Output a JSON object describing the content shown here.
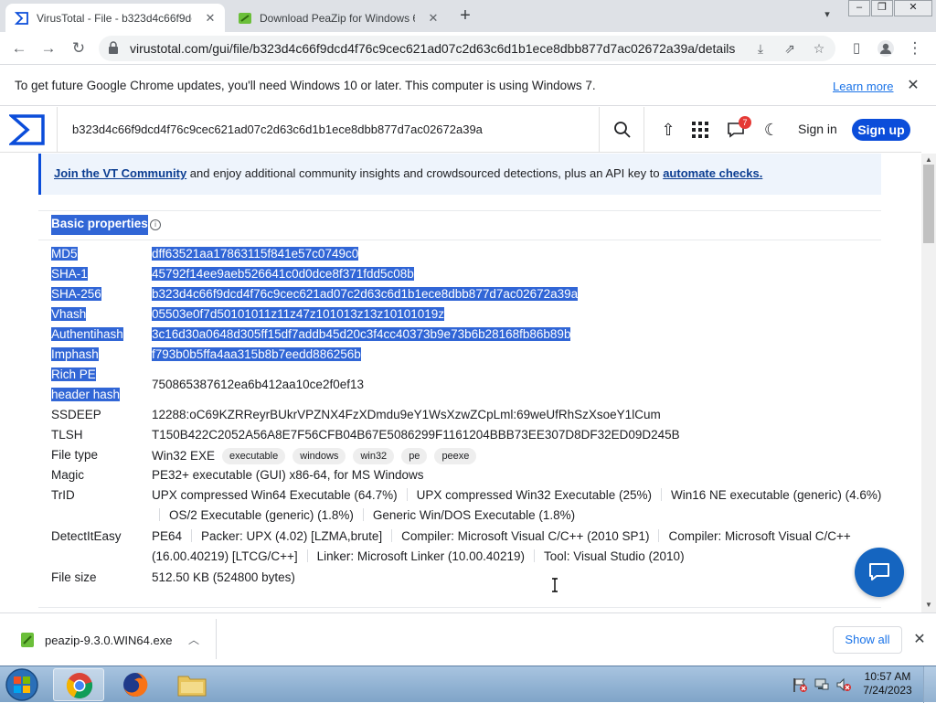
{
  "browser": {
    "tabs": [
      {
        "title": "VirusTotal - File - b323d4c66f9dc",
        "active": true
      },
      {
        "title": "Download PeaZip for Windows 6",
        "active": false
      }
    ],
    "new_tab": "+",
    "url": "virustotal.com/gui/file/b323d4c66f9dcd4f76c9cec621ad07c2d63c6d1b1ece8dbb877d7ac02672a39a/details"
  },
  "infobar": {
    "message": "To get future Google Chrome updates, you'll need Windows 10 or later. This computer is using Windows 7.",
    "learn_more": "Learn more"
  },
  "vt_header": {
    "search_value": "b323d4c66f9dcd4f76c9cec621ad07c2d63c6d1b1ece8dbb877d7ac02672a39a",
    "notification_count": "7",
    "sign_in": "Sign in",
    "sign_up": "Sign up"
  },
  "community_banner": {
    "link": "Join the VT Community",
    "text": " and enjoy additional community insights and crowdsourced detections, plus an API key to ",
    "link2": "automate checks."
  },
  "basic_properties": {
    "title": "Basic properties",
    "md5_label": "MD5",
    "md5": "dff63521aa17863115f841e57c0749c0",
    "sha1_label": "SHA-1",
    "sha1": "45792f14ee9aeb526641c0d0dce8f371fdd5c08b",
    "sha256_label": "SHA-256",
    "sha256": "b323d4c66f9dcd4f76c9cec621ad07c2d63c6d1b1ece8dbb877d7ac02672a39a",
    "vhash_label": "Vhash",
    "vhash": "05503e0f7d50101011z11z47z101013z13z10101019z",
    "authentihash_label": "Authentihash",
    "authentihash": "3c16d30a0648d305ff15df7addb45d20c3f4cc40373b9e73b6b28168fb86b89b",
    "imphash_label": "Imphash",
    "imphash": "f793b0b5ffa4aa315b8b7eedd886256b",
    "richpe_label_1": "Rich PE",
    "richpe_label_2": "header hash",
    "richpe": "750865387612ea6b412aa10ce2f0ef13",
    "ssdeep_label": "SSDEEP",
    "ssdeep": "12288:oC69KZRReyrBUkrVPZNX4FzXDmdu9eY1WsXzwZCpLml:69weUfRhSzXsoeY1lCum",
    "tlsh_label": "TLSH",
    "tlsh": "T150B422C2052A56A8E7F56CFB04B67E5086299F1161204BBB73EE307D8DF32ED09D245B",
    "filetype_label": "File type",
    "filetype": "Win32 EXE",
    "filetype_tags": [
      "executable",
      "windows",
      "win32",
      "pe",
      "peexe"
    ],
    "magic_label": "Magic",
    "magic": "PE32+ executable (GUI) x86-64, for MS Windows",
    "trid_label": "TrID",
    "trid_1": "UPX compressed Win64 Executable (64.7%)",
    "trid_2": "UPX compressed Win32 Executable (25%)",
    "trid_3": "Win16 NE executable (generic) (4.6%)",
    "trid_4": "OS/2 Executable (generic) (1.8%)",
    "trid_5": "Generic Win/DOS Executable (1.8%)",
    "die_label": "DetectItEasy",
    "die_1": "PE64",
    "die_2": "Packer: UPX (4.02) [LZMA,brute]",
    "die_3": "Compiler: Microsoft Visual C/C++ (2010 SP1)",
    "die_4": "Compiler: Microsoft Visual C/C++",
    "die_5": "(16.00.40219) [LTCG/C++]",
    "die_6": "Linker: Microsoft Linker (10.00.40219)",
    "die_7": "Tool: Visual Studio (2010)",
    "filesize_label": "File size",
    "filesize": "512.50 KB (524800 bytes)"
  },
  "downloads": {
    "filename": "peazip-9.3.0.WIN64.exe",
    "show_all": "Show all"
  },
  "taskbar": {
    "time": "10:57 AM",
    "date": "7/24/2023"
  },
  "colors": {
    "vt_blue": "#0b4dda",
    "selection": "#3166d6",
    "chat_button": "#1565c0"
  }
}
